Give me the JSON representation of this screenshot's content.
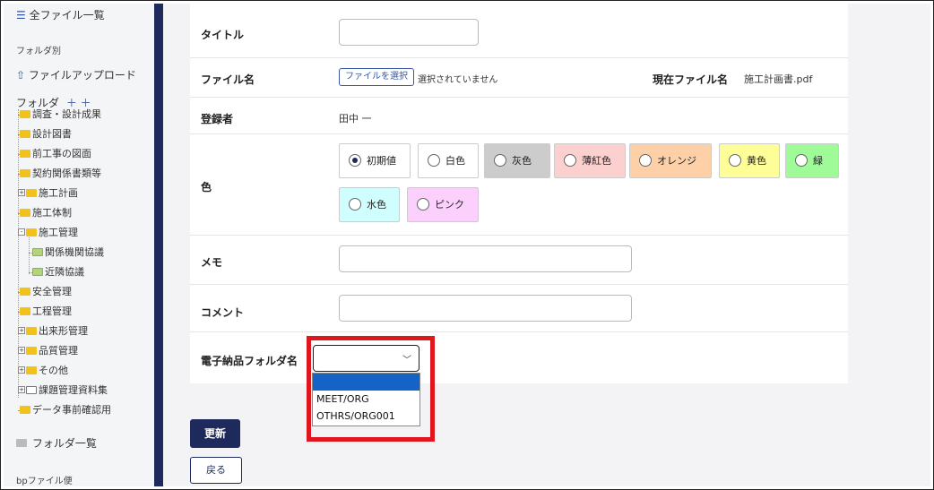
{
  "sidebar": {
    "all_files": "全ファイル一覧",
    "by_folder": "フォルダ別",
    "upload": "ファイルアップロード",
    "folder_header": "フォルダ",
    "expand_collapse_icons": "＋ ＋",
    "tree": [
      {
        "label": "調査・設計成果",
        "icon": "folder-yellow"
      },
      {
        "label": "設計図書",
        "icon": "folder-yellow"
      },
      {
        "label": "前工事の図面",
        "icon": "folder-yellow"
      },
      {
        "label": "契約関係書類等",
        "icon": "folder-yellow"
      },
      {
        "label": "施工計画",
        "icon": "folder-yellow",
        "expander": "+"
      },
      {
        "label": "施工体制",
        "icon": "folder-yellow"
      },
      {
        "label": "施工管理",
        "icon": "folder-yellow",
        "expander": "-"
      },
      {
        "label": "関係機関協議",
        "icon": "folder-green"
      },
      {
        "label": "近隣協議",
        "icon": "folder-green"
      },
      {
        "label": "安全管理",
        "icon": "folder-yellow"
      },
      {
        "label": "工程管理",
        "icon": "folder-yellow"
      },
      {
        "label": "出来形管理",
        "icon": "folder-yellow",
        "expander": "+"
      },
      {
        "label": "品質管理",
        "icon": "folder-yellow",
        "expander": "+"
      },
      {
        "label": "その他",
        "icon": "folder-yellow",
        "expander": "+"
      },
      {
        "label": "課題管理資料集",
        "icon": "folder-empty",
        "expander": "+"
      },
      {
        "label": "データ事前確認用",
        "icon": "folder-yellow"
      }
    ],
    "folder_list": "フォルダ一覧",
    "bp_files": "bpファイル便"
  },
  "form": {
    "title_label": "タイトル",
    "title_value": "",
    "filename_label": "ファイル名",
    "file_button": "ファイルを選択",
    "no_file_selected": "選択されていません",
    "current_file_label": "現在ファイル名",
    "current_file_value": "施工計画書.pdf",
    "registrant_label": "登録者",
    "registrant_value": "田中 一",
    "color_label": "色",
    "colors": [
      {
        "label": "初期値",
        "bg": "#ffffff",
        "checked": true
      },
      {
        "label": "白色",
        "bg": "#ffffff",
        "checked": false
      },
      {
        "label": "灰色",
        "bg": "#cccccc",
        "checked": false
      },
      {
        "label": "薄紅色",
        "bg": "#fdd0d0",
        "checked": false
      },
      {
        "label": "オレンジ",
        "bg": "#fdd0a8",
        "checked": false
      },
      {
        "label": "黄色",
        "bg": "#fefe98",
        "checked": false
      },
      {
        "label": "緑",
        "bg": "#9efb98",
        "checked": false
      },
      {
        "label": "水色",
        "bg": "#d0fefe",
        "checked": false
      },
      {
        "label": "ピンク",
        "bg": "#fcd0fc",
        "checked": false
      }
    ],
    "memo_label": "メモ",
    "memo_value": "",
    "comment_label": "コメント",
    "comment_value": "",
    "efolder_label": "電子納品フォルダ名",
    "efolder_value": "",
    "efolder_options": [
      "",
      "MEET/ORG",
      "OTHRS/ORG001"
    ],
    "highlight_color": "#e0161f"
  },
  "actions": {
    "update": "更新",
    "back": "戻る"
  }
}
